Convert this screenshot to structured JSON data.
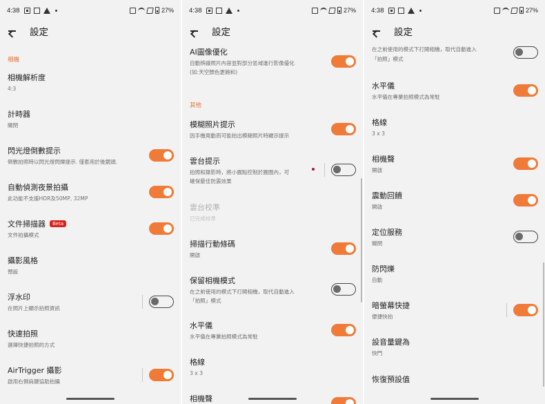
{
  "status": {
    "time": "4:38",
    "battery": "27%"
  },
  "appbar": {
    "title": "設定"
  },
  "colors": {
    "accent": "#f07a38",
    "background": "#f2f2f2",
    "beta": "#d8221c"
  },
  "panel1": {
    "section_camera": "相機",
    "resolution": {
      "title": "相機解析度",
      "sub": "4:3"
    },
    "timer": {
      "title": "計時器",
      "sub": "關閉"
    },
    "flash_countdown": {
      "title": "閃光燈倒數提示",
      "sub": "倒數拍照時以閃光燈閃爍提示. 僅套用於後鏡頭.",
      "on": true
    },
    "night": {
      "title": "自動偵測夜景拍攝",
      "sub": "此功能不支援HDR及50MP, 32MP",
      "on": true
    },
    "doc_scanner": {
      "title": "文件掃描器",
      "badge": "Beta",
      "sub": "文件拍攝模式",
      "on": true
    },
    "style": {
      "title": "攝影風格",
      "sub": "預設"
    },
    "watermark": {
      "title": "浮水印",
      "sub": "在照片上顯示拍照資訊",
      "on": false
    },
    "quick_shot": {
      "title": "快速拍照",
      "sub": "選擇快捷拍照的方式"
    },
    "airtrigger": {
      "title": "AirTrigger 攝影",
      "sub": "啟用右側肩鍵協助拍攝",
      "on": true
    }
  },
  "panel2": {
    "ai_enhance": {
      "title": "AI圖像優化",
      "sub1": "自動辨識照片內容並對部分區域進行影像優化",
      "sub2": "(如:天空顏色更飽和)",
      "on": true
    },
    "section_other": "其他",
    "blur_hint": {
      "title": "模糊照片提示",
      "sub": "因手機晃動而可能拍出模糊照片時顯示提示",
      "on": true
    },
    "gimbal_hint": {
      "title": "雲台提示",
      "sub1": "拍照和錄影時，將小圓點控制於圓圈內，可",
      "sub2": "確保最佳防震效果",
      "on": false
    },
    "gimbal_calibration": {
      "title": "雲台校準",
      "sub": "已完成校準"
    },
    "barcode": {
      "title": "掃描行動條碼",
      "sub": "開啟",
      "on": true
    },
    "keep_mode": {
      "title": "保留相機模式",
      "sub1": "在之前使用的模式下打開相機，取代自動進入",
      "sub2": "「拍照」模式",
      "on": false
    },
    "level": {
      "title": "水平儀",
      "sub": "水平儀在專業拍照模式為常駐",
      "on": true
    },
    "grid": {
      "title": "格線",
      "sub": "3 x 3"
    },
    "shutter_sound": {
      "title": "相機聲",
      "on": true
    }
  },
  "panel3": {
    "keep_mode_tail": {
      "sub1": "在之前使用的模式下打開相機，取代自動進入",
      "sub2": "「拍照」模式",
      "on": false
    },
    "level": {
      "title": "水平儀",
      "sub": "水平儀在專業拍照模式為常駐",
      "on": true
    },
    "grid": {
      "title": "格線",
      "sub": "3 x 3"
    },
    "shutter_sound": {
      "title": "相機聲",
      "sub": "開啟",
      "on": true
    },
    "vibration": {
      "title": "震動回饋",
      "sub": "開啟",
      "on": true
    },
    "location": {
      "title": "定位服務",
      "sub": "關閉",
      "on": false
    },
    "antiflicker": {
      "title": "防閃爍",
      "sub": "自動"
    },
    "dark_shortcut": {
      "title": "暗螢幕快捷",
      "sub": "便捷快拍",
      "on": true
    },
    "volume_key": {
      "title": "設音量鍵為",
      "sub": "快門"
    },
    "reset": {
      "title": "恢復預設值"
    }
  }
}
